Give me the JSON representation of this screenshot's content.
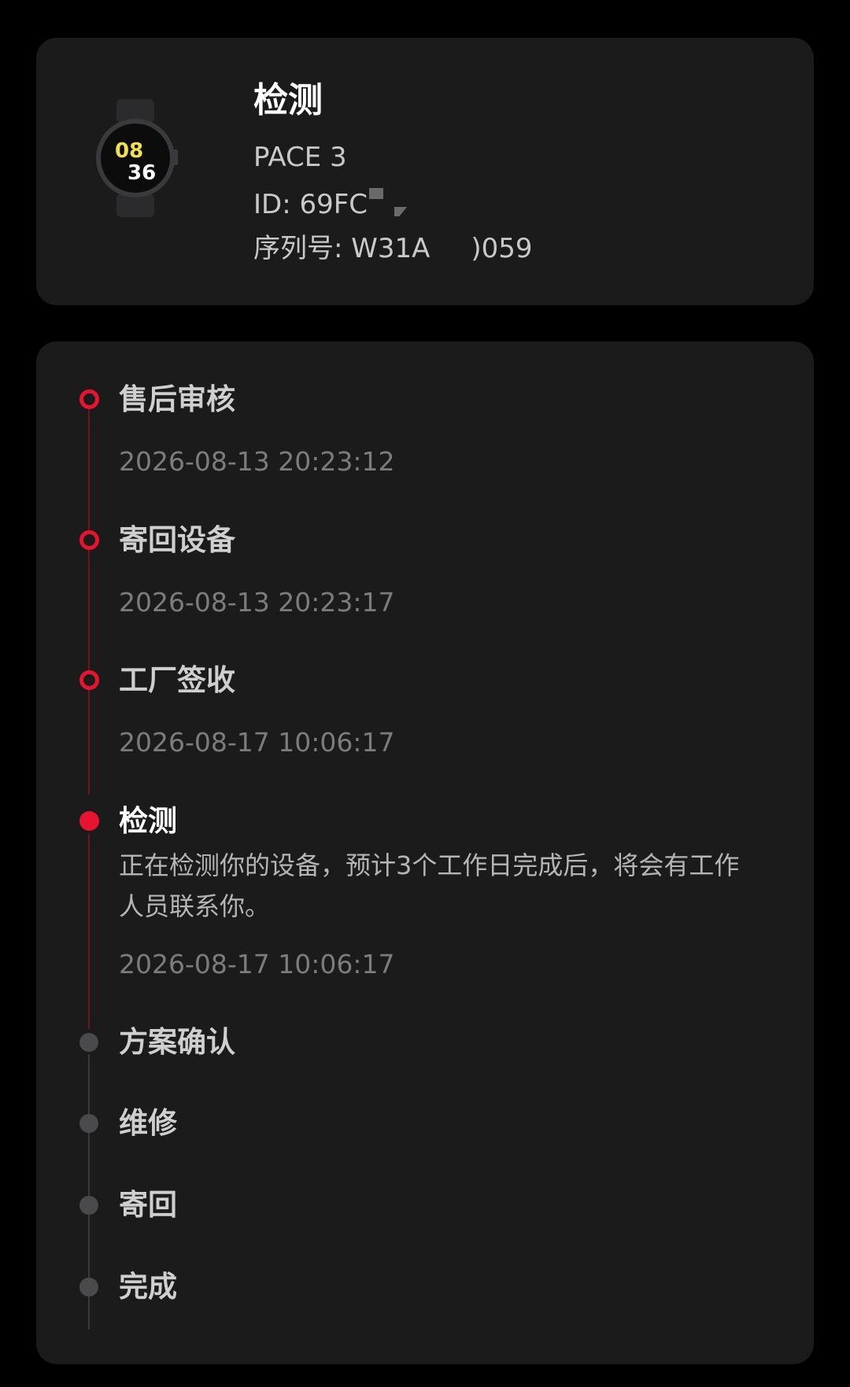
{
  "device": {
    "title": "检测",
    "model": "PACE 3",
    "id_text": "ID: 69FC",
    "serial_prefix": "序列号: W31A",
    "serial_suffix": ")059",
    "watch_time_hour": "08",
    "watch_time_min": "36"
  },
  "timeline": {
    "steps": [
      {
        "title": "售后审核",
        "time": "2026-08-13 20:23:12",
        "status": "done"
      },
      {
        "title": "寄回设备",
        "time": "2026-08-13 20:23:17",
        "status": "done"
      },
      {
        "title": "工厂签收",
        "time": "2026-08-17 10:06:17",
        "status": "done"
      },
      {
        "title": "检测",
        "desc": "正在检测你的设备，预计3个工作日完成后，将会有工作人员联系你。",
        "time": "2026-08-17 10:06:17",
        "status": "current"
      },
      {
        "title": "方案确认",
        "status": "pending"
      },
      {
        "title": "维修",
        "status": "pending"
      },
      {
        "title": "寄回",
        "status": "pending"
      },
      {
        "title": "完成",
        "status": "pending"
      }
    ]
  },
  "colors": {
    "background": "#000000",
    "card": "#1b1b1c",
    "accent": "#e8142f",
    "pending": "#4a4a4c"
  }
}
